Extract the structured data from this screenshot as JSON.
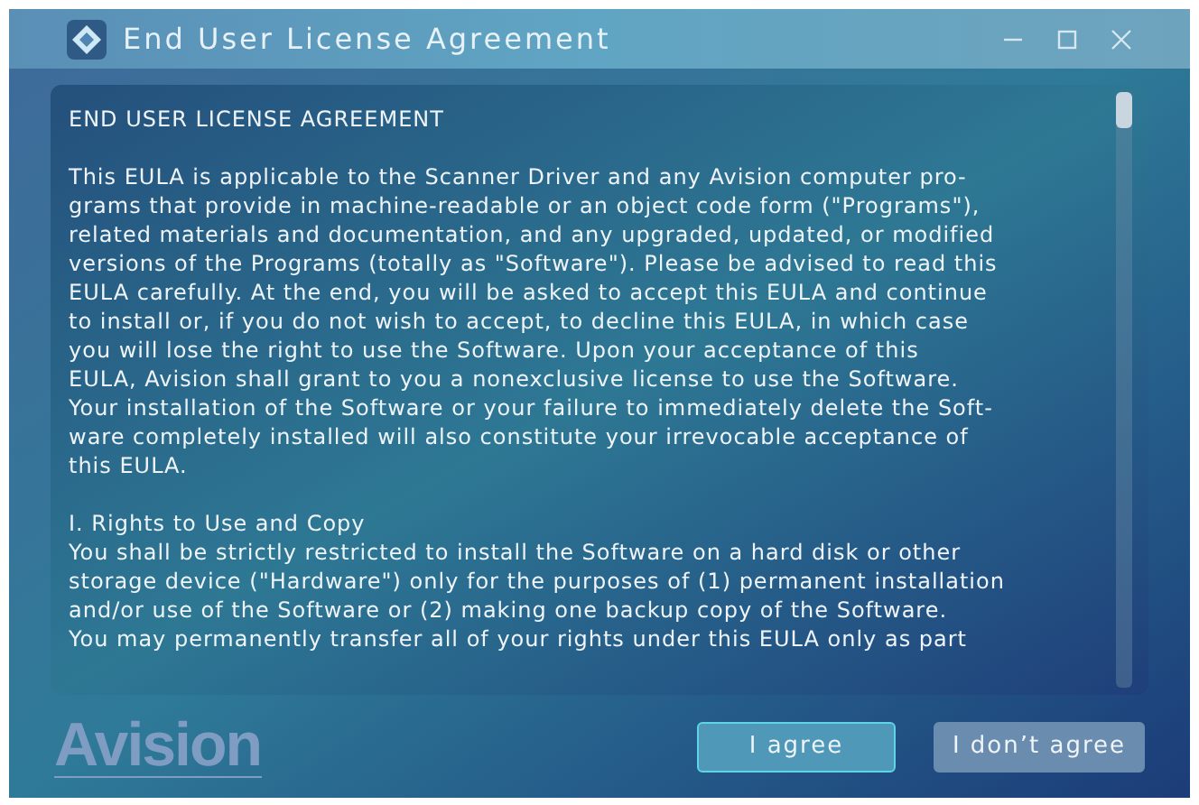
{
  "window": {
    "title": "End User License Agreement"
  },
  "document": {
    "heading": "END USER LICENSE AGREEMENT",
    "paragraphs": [
      {
        "lines": [
          "This EULA is applicable to the Scanner Driver and any Avision computer pro-",
          "grams that provide in machine-readable or an object code form (\"Programs\"),",
          "related materials and documentation, and any upgraded, updated, or modified",
          "versions of the Programs (totally as \"Software\"). Please be advised to read this",
          "EULA carefully. At the end, you will be asked to accept this EULA and continue",
          "to install or, if you do not wish to accept, to decline this EULA, in which case",
          "you will lose the right to use the Software. Upon your acceptance of this",
          "EULA, Avision shall grant to you a nonexclusive license to use the Software.",
          "Your installation of the Software or your failure to immediately delete the Soft-",
          "ware completely installed will also constitute your irrevocable acceptance of",
          "this EULA."
        ]
      },
      {
        "lines": [
          "I. Rights to Use and Copy",
          "You shall be strictly restricted to install the Software on a hard disk or other",
          "storage device (\"Hardware\") only for the purposes of (1) permanent installation",
          "and/or use of the Software or (2) making one backup copy of the Software.",
          "You may permanently transfer all of your rights under this EULA only as part"
        ]
      }
    ]
  },
  "logo": "Avision",
  "buttons": [
    {
      "label": "I agree",
      "focused": true
    },
    {
      "label": "I don’t agree",
      "focused": false
    }
  ]
}
